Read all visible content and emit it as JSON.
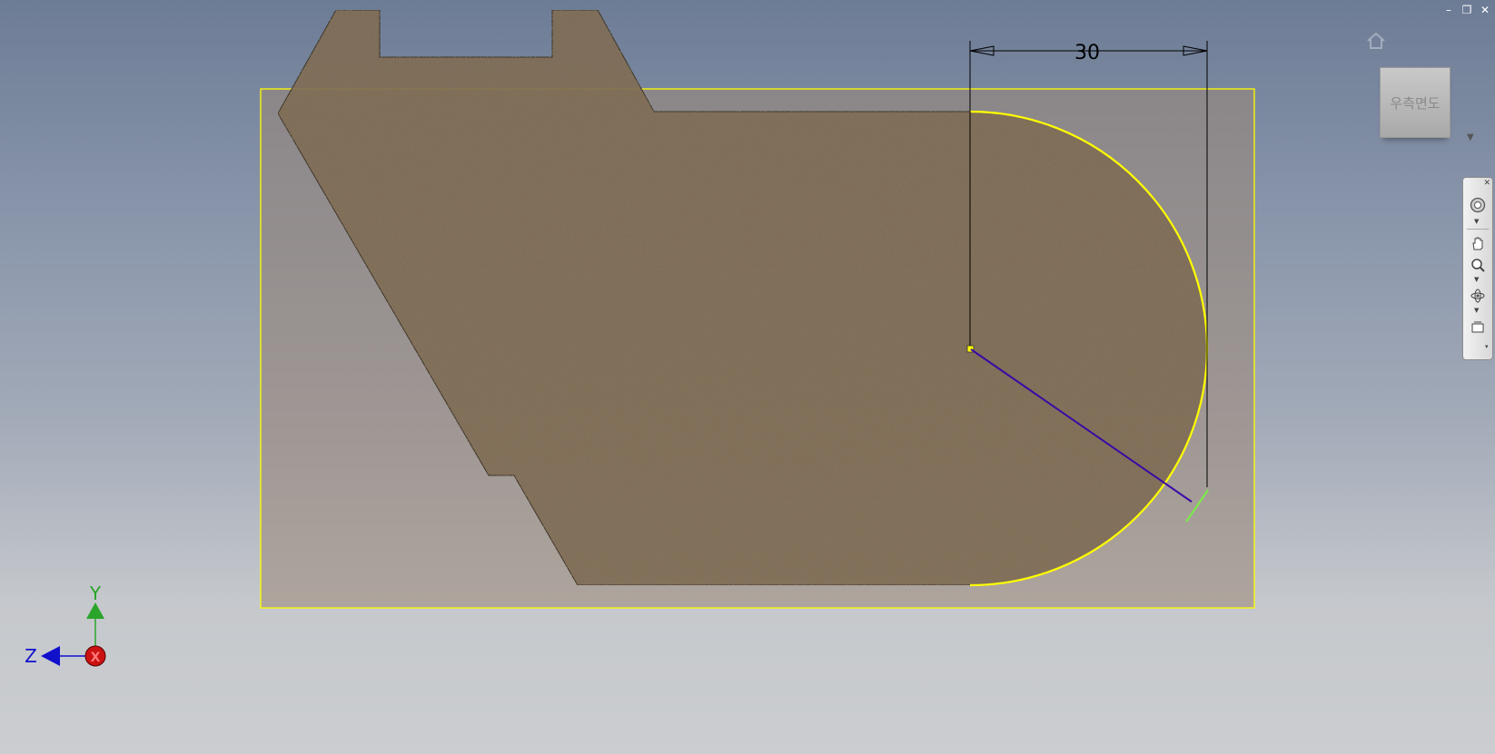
{
  "window": {
    "minimize": "–",
    "restore": "❐",
    "close": "✕"
  },
  "viewcube": {
    "face_label": "우측면도",
    "home_icon": "home-icon",
    "menu_icon": "chevron-down-icon"
  },
  "navbar": {
    "icons": [
      "steering-wheel-icon",
      "pan-icon",
      "zoom-icon",
      "orbit-icon",
      "look-at-icon"
    ]
  },
  "dimension": {
    "value": "30"
  },
  "triad": {
    "y_label": "Y",
    "z_label": "Z",
    "x_label": "X"
  },
  "colors": {
    "selection": "#ffff00",
    "dimension": "#000000",
    "radius_line": "#3a0aa6",
    "preview": "#7fe84b",
    "y_axis": "#2aa52a",
    "z_axis": "#1111cc",
    "x_axis": "#cc1111"
  }
}
